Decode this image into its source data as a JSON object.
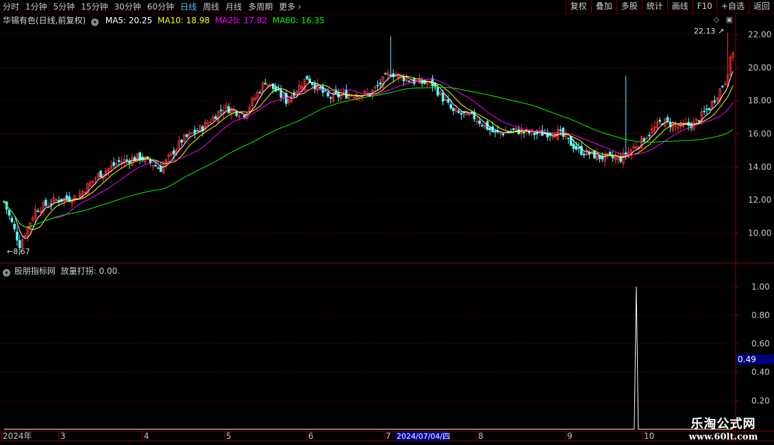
{
  "toolbar": {
    "periods": [
      "分时",
      "1分钟",
      "5分钟",
      "15分钟",
      "30分钟",
      "60分钟",
      "日线",
      "周线",
      "月线",
      "多周期",
      "更多"
    ],
    "active": "日线",
    "right_buttons": [
      "复权",
      "叠加",
      "多股",
      "统计",
      "画线",
      "F10",
      "+自选",
      "返回"
    ]
  },
  "header": {
    "stock": "华锡有色(日线,前复权)",
    "ma5": "MA5: 20.25",
    "ma10": "MA10: 18.98",
    "ma20": "MA20: 17.82",
    "ma60": "MA60: 16.35"
  },
  "indicator": {
    "name": "股朋指标网",
    "value_label": "放量打拐: 0.00",
    "current_value": "0.49"
  },
  "annotations": {
    "high": "22.13",
    "low": "8.67"
  },
  "xaxis": {
    "labels": [
      "2024年",
      "3",
      "4",
      "5",
      "6",
      "7",
      "8",
      "9",
      "10"
    ],
    "cursor_date": "2024/07/04/四"
  },
  "watermark": {
    "line1": "乐淘公式网",
    "line2": "www.60lt.com"
  },
  "colors": {
    "up": "#ff3232",
    "down": "#54ffff",
    "ma5": "#ffffff",
    "ma10": "#ffff00",
    "ma20": "#ff00ff",
    "ma60": "#00ff00",
    "grid": "#8b0000",
    "axis_text": "#c8c8c8"
  },
  "chart_data": [
    {
      "type": "candlestick",
      "title": "华锡有色(日线,前复权)",
      "ylim": [
        8.2,
        22.6
      ],
      "yticks": [
        10.0,
        12.0,
        14.0,
        16.0,
        18.0,
        20.0,
        22.0
      ],
      "grid": true,
      "anchors": [
        [
          0,
          11.9
        ],
        [
          6,
          9.3
        ],
        [
          12,
          11.4
        ],
        [
          20,
          12.0
        ],
        [
          28,
          12.2
        ],
        [
          36,
          13.5
        ],
        [
          44,
          14.3
        ],
        [
          52,
          14.6
        ],
        [
          60,
          13.9
        ],
        [
          68,
          15.6
        ],
        [
          76,
          16.4
        ],
        [
          84,
          17.6
        ],
        [
          92,
          17.2
        ],
        [
          100,
          19.2
        ],
        [
          108,
          18.0
        ],
        [
          116,
          19.4
        ],
        [
          124,
          18.2
        ],
        [
          132,
          18.4
        ],
        [
          140,
          18.4
        ],
        [
          148,
          19.7
        ],
        [
          156,
          19.2
        ],
        [
          164,
          19.0
        ],
        [
          172,
          17.3
        ],
        [
          180,
          17.0
        ],
        [
          188,
          16.0
        ],
        [
          196,
          16.2
        ],
        [
          204,
          16.0
        ],
        [
          212,
          16.1
        ],
        [
          220,
          15.0
        ],
        [
          228,
          14.6
        ],
        [
          236,
          14.5
        ],
        [
          244,
          15.6
        ],
        [
          252,
          16.8
        ],
        [
          258,
          16.4
        ],
        [
          264,
          16.6
        ],
        [
          270,
          17.6
        ],
        [
          276,
          19.2
        ],
        [
          279,
          21.0
        ]
      ],
      "low_marker": 8.67,
      "high_marker": 22.13,
      "ma_legend": [
        "MA5",
        "MA10",
        "MA20",
        "MA60"
      ]
    },
    {
      "type": "line",
      "series": [
        {
          "name": "放量打拐",
          "spike_at": 242,
          "spike_value": 1.0
        }
      ],
      "ylim": [
        0.0,
        1.1
      ],
      "yticks": [
        0.2,
        0.4,
        0.6,
        0.8,
        1.0
      ],
      "current_value": 0.49
    }
  ]
}
